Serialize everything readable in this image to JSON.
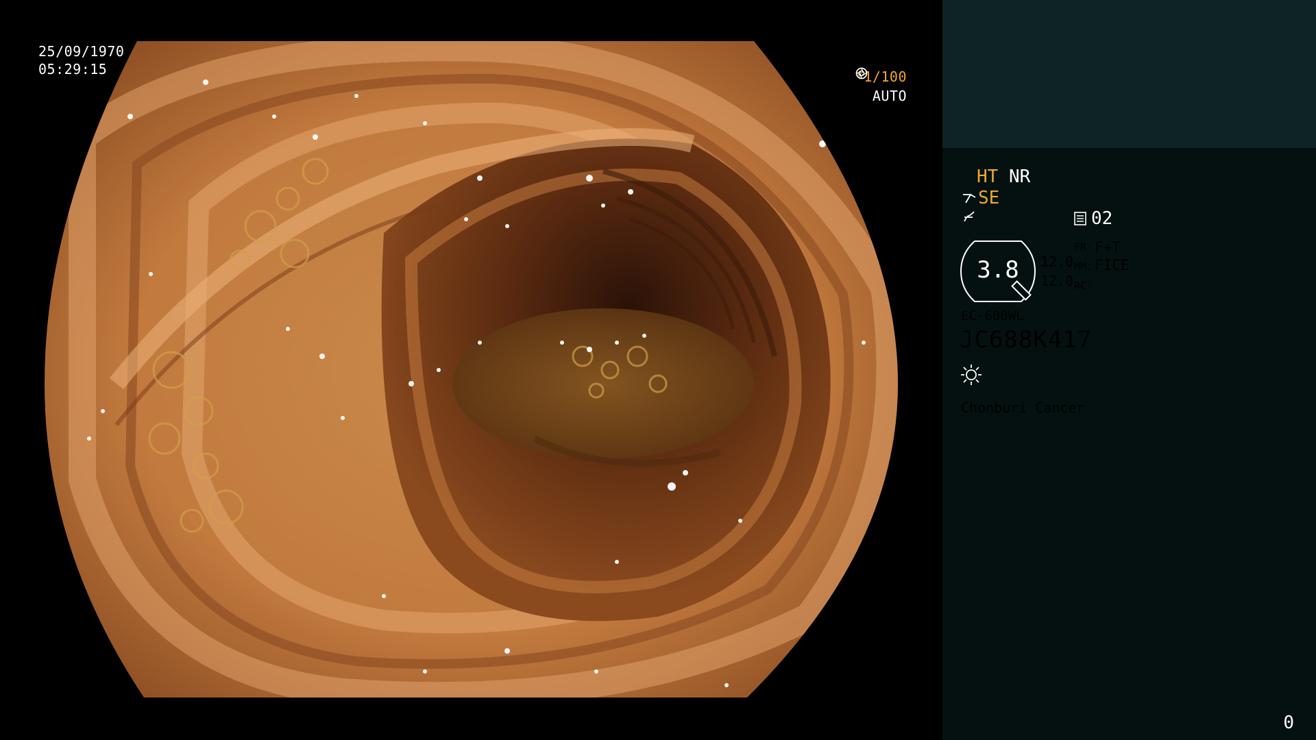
{
  "overlay": {
    "date": "25/09/1970",
    "time": "05:29:15",
    "shutter": "*1/100",
    "iris_mode": "AUTO"
  },
  "panel": {
    "enhance_ht": "HT",
    "enhance_nr": "NR",
    "structure_label": "SE",
    "record_count": "02",
    "zoom_value": "3.8",
    "values": [
      "12.0",
      "12.0"
    ],
    "labels": [
      "FR:",
      "MM:",
      "RC:"
    ],
    "modes": [
      "F+T",
      "FICE",
      ""
    ],
    "scope_model": "EC-600WL",
    "serial": "JC688K417",
    "hospital": "Chonburi Cancer",
    "counter": "0"
  },
  "colors": {
    "accent_amber": "#f0a830",
    "panel_top": "#0e2424",
    "panel_bottom": "#051111"
  },
  "icons": {
    "shutter": "aperture-icon",
    "iris": "iris-icon",
    "structure": "structure-enhance-icon",
    "freeze": "freeze-icon",
    "record": "record-icon",
    "light": "light-source-icon"
  }
}
